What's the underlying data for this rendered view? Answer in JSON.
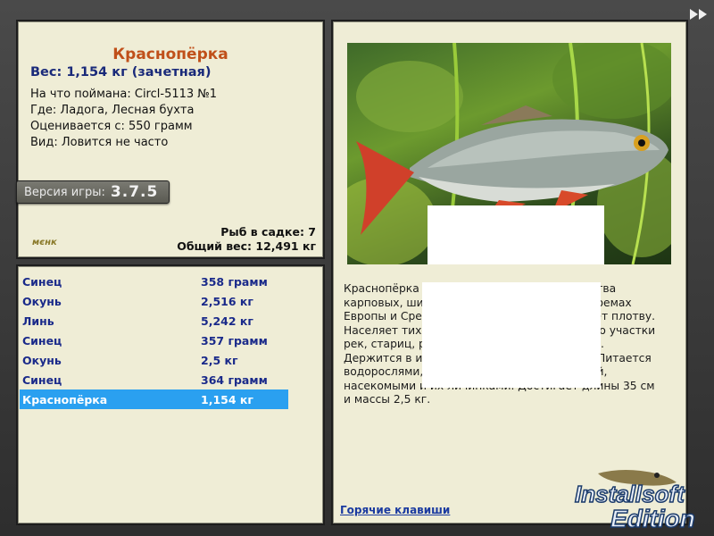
{
  "info": {
    "fish_name": "Краснопёрка",
    "weight_line": "Вес: 1,154 кг (зачетная)",
    "caught_on": "На что поймана: Circl-5113 №1",
    "location": "Где: Ладога, Лесная бухта",
    "valued_from": "Оценивается с: 550 грамм",
    "kind": "Вид: Ловится не часто",
    "version_label": "Версия игры:",
    "version_value": "3.7.5",
    "logo": "мєнк",
    "keep_count": "Рыб в садке: 7",
    "total_weight": "Общий вес: 12,491 кг"
  },
  "catch_list": [
    {
      "name": "Синец",
      "weight": "358 грамм"
    },
    {
      "name": "Окунь",
      "weight": "2,516 кг"
    },
    {
      "name": "Линь",
      "weight": "5,242 кг"
    },
    {
      "name": "Синец",
      "weight": "357 грамм"
    },
    {
      "name": "Окунь",
      "weight": "2,5 кг"
    },
    {
      "name": "Синец",
      "weight": "364 грамм"
    },
    {
      "name": "Краснопёрка",
      "weight": "1,154 кг"
    }
  ],
  "detail": {
    "description": "Краснопёрка — пресноводная рыба семейства карповых, широко распространенная в водоемах Европы и Средней Азии. Внешне напоминает плотву. Населяет тихие, покрытые растительностью участки рек, стариц, речных заводей, прудов и озер. Держится в и в зарослях других растений. Питается водорослями, молодыми побегами растений, насекомыми и их личинками. Достигает длины 35 см и массы 2,5 кг.",
    "hotkeys_link": "Горячие клавиши"
  },
  "watermark": {
    "line1": "Installsoft",
    "line2": "Edition"
  },
  "colors": {
    "panel_bg": "#efedd6",
    "title": "#c0501a",
    "weight": "#1a2a7a",
    "selected_row": "#2aa0f0"
  }
}
